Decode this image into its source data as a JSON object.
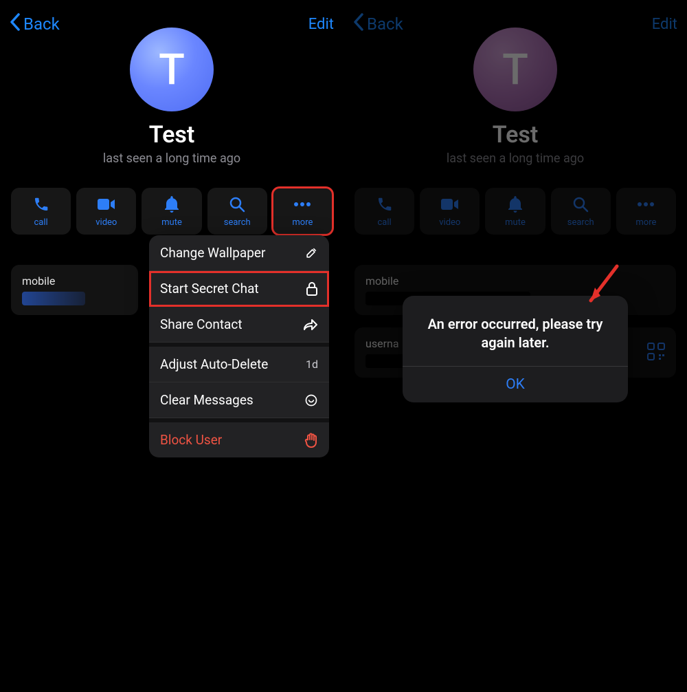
{
  "nav": {
    "back": "Back",
    "edit": "Edit"
  },
  "profile": {
    "avatar_initial": "T",
    "name": "Test",
    "lastseen": "last seen a long time ago"
  },
  "actions": {
    "call": "call",
    "video": "video",
    "mute": "mute",
    "search": "search",
    "more": "more"
  },
  "fields": {
    "mobile": "mobile",
    "username": "userna"
  },
  "menu": {
    "change_wallpaper": "Change Wallpaper",
    "start_secret_chat": "Start Secret Chat",
    "share_contact": "Share Contact",
    "adjust_auto_delete": "Adjust Auto-Delete",
    "auto_delete_value": "1d",
    "clear_messages": "Clear Messages",
    "block_user": "Block User"
  },
  "alert": {
    "message": "An error occurred, please try again later.",
    "ok": "OK"
  },
  "colors": {
    "accent": "#2d7ef7",
    "danger": "#ef5343",
    "highlight": "#e3302a"
  }
}
